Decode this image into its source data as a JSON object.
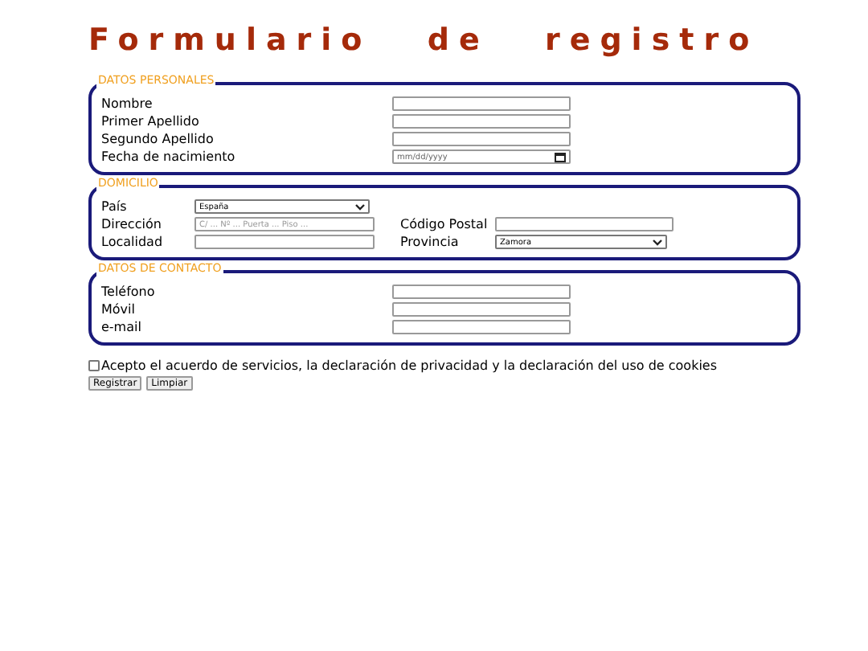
{
  "title": "Formulario de registro",
  "sections": [
    {
      "legend": "DATOS PERSONALES",
      "rows": [
        [
          {
            "label": "Nombre",
            "kind": "text"
          }
        ],
        [
          {
            "label": "Primer Apellido",
            "kind": "text"
          }
        ],
        [
          {
            "label": "Segundo Apellido",
            "kind": "text"
          }
        ],
        [
          {
            "label": "Fecha de nacimiento",
            "kind": "date",
            "placeholder": "mm/dd/yyyy"
          }
        ]
      ]
    },
    {
      "legend": "DOMICILIO",
      "rows": [
        [
          {
            "label": "País",
            "kind": "select",
            "value": "España"
          }
        ],
        [
          {
            "label": "Dirección",
            "kind": "text",
            "placeholder": "C/ ... Nº ... Puerta ... Piso ..."
          },
          {
            "label": "Código Postal",
            "kind": "text"
          }
        ],
        [
          {
            "label": "Localidad",
            "kind": "text"
          },
          {
            "label": "Provincia",
            "kind": "select",
            "value": "Zamora"
          }
        ]
      ]
    },
    {
      "legend": "DATOS DE CONTACTO",
      "rows": [
        [
          {
            "label": "Teléfono",
            "kind": "text"
          }
        ],
        [
          {
            "label": "Móvil",
            "kind": "text"
          }
        ],
        [
          {
            "label": "e-mail",
            "kind": "text"
          }
        ]
      ]
    }
  ],
  "consent": {
    "label": "Acepto el acuerdo de servicios, la declaración de privacidad y la declaración del uso de cookies",
    "checked": false
  },
  "buttons": [
    "Registrar",
    "Limpiar"
  ]
}
